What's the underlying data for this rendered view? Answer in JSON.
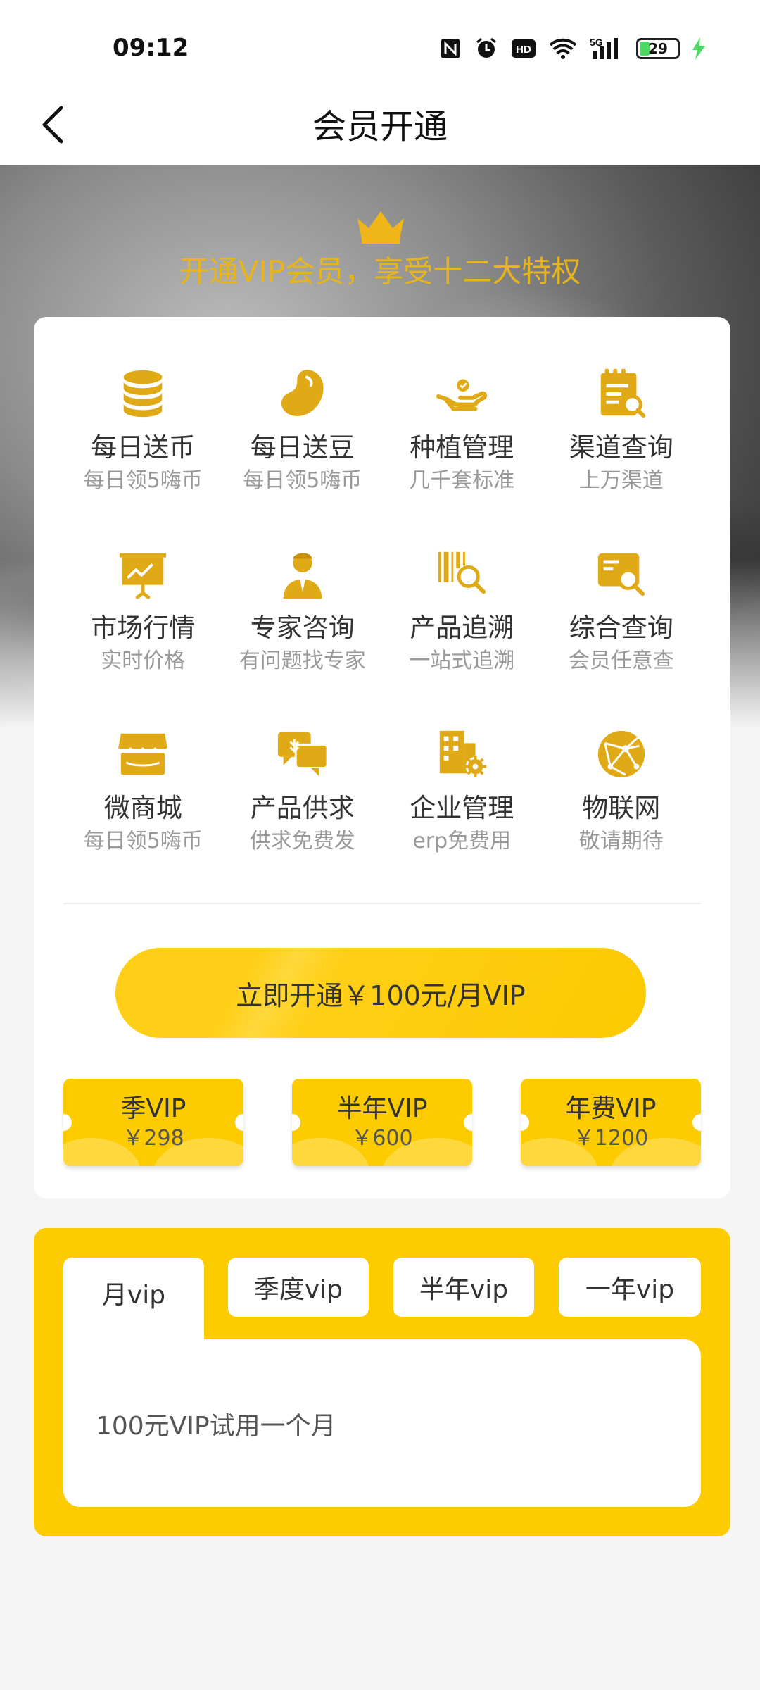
{
  "status_bar": {
    "time": "09:12",
    "battery": "29",
    "network": "5G",
    "hd": "HD"
  },
  "nav": {
    "title": "会员开通"
  },
  "hero": {
    "tagline": "开通VIP会员，享受十二大特权"
  },
  "features": [
    {
      "title": "每日送币",
      "subtitle": "每日领5嗨币",
      "icon": "coin-stack-icon"
    },
    {
      "title": "每日送豆",
      "subtitle": "每日领5嗨币",
      "icon": "bean-icon"
    },
    {
      "title": "种植管理",
      "subtitle": "几千套标准",
      "icon": "hand-plant-icon"
    },
    {
      "title": "渠道查询",
      "subtitle": "上万渠道",
      "icon": "clipboard-search-icon"
    },
    {
      "title": "市场行情",
      "subtitle": "实时价格",
      "icon": "chart-board-icon"
    },
    {
      "title": "专家咨询",
      "subtitle": "有问题找专家",
      "icon": "expert-icon"
    },
    {
      "title": "产品追溯",
      "subtitle": "一站式追溯",
      "icon": "barcode-search-icon"
    },
    {
      "title": "综合查询",
      "subtitle": "会员任意查",
      "icon": "document-search-icon"
    },
    {
      "title": "微商城",
      "subtitle": "每日领5嗨币",
      "icon": "store-icon"
    },
    {
      "title": "产品供求",
      "subtitle": "供求免费发",
      "icon": "chat-bubbles-icon"
    },
    {
      "title": "企业管理",
      "subtitle": "erp免费用",
      "icon": "building-gear-icon"
    },
    {
      "title": "物联网",
      "subtitle": "敬请期待",
      "icon": "network-globe-icon"
    }
  ],
  "cta": {
    "label": "立即开通￥100元/月VIP"
  },
  "plans": [
    {
      "name": "季VIP",
      "price": "￥298"
    },
    {
      "name": "半年VIP",
      "price": "￥600"
    },
    {
      "name": "年费VIP",
      "price": "￥1200"
    }
  ],
  "tabs": [
    {
      "label": "月vip"
    },
    {
      "label": "季度vip"
    },
    {
      "label": "半年vip"
    },
    {
      "label": "一年vip"
    }
  ],
  "tab_content": "100元VIP试用一个月",
  "colors": {
    "accent": "#fccc00",
    "icon": "#e0a916",
    "tagline": "#e7b51b"
  }
}
